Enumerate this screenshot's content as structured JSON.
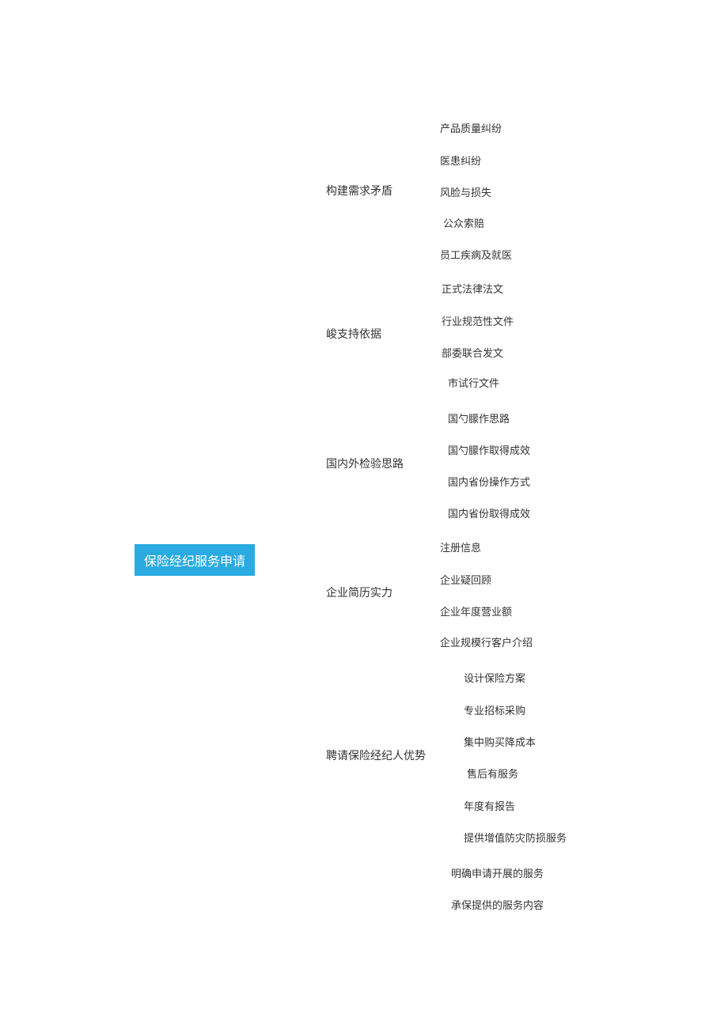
{
  "root": "保险经纪服务申请",
  "branches": [
    {
      "label": "构建需求矛盾",
      "leaves": [
        "产品质量纠纷",
        "医患纠纷",
        "风脸与损失",
        "公众索赔",
        "员工疾病及就医"
      ]
    },
    {
      "label": "峻支持依据",
      "leaves": [
        "正式法律法文",
        "行业规范性文件",
        "部委联合发文",
        "市试行文件"
      ]
    },
    {
      "label": "国内外检验思路",
      "leaves": [
        "国勺朦作思路",
        "国勺朦作取得成效",
        "国内省份操作方式",
        "国内省份取得成效"
      ]
    },
    {
      "label": "企业简历实力",
      "leaves": [
        "注册信息",
        "企业疑回顾",
        "企业年度营业额",
        "企业规模行客户介绍"
      ]
    },
    {
      "label": "聘请保险经纪人优势",
      "leaves": [
        "设计保险方案",
        "专业招标采购",
        "集中购买降成本",
        "售后有服务",
        "年度有报告",
        "提供增值防灾防损服务"
      ]
    }
  ],
  "extra_leaves": [
    "明确申请开展的服务",
    "承保提供的服务内容"
  ]
}
